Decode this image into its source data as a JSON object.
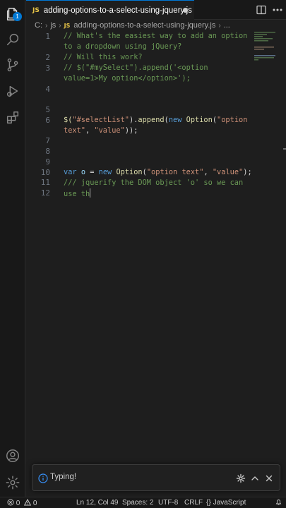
{
  "tab": {
    "icon_text": "JS",
    "title": "adding-options-to-a-select-using-jquery.js"
  },
  "breadcrumb": {
    "drive": "C:",
    "folder": "js",
    "icon_text": "JS",
    "file": "adding-options-to-a-select-using-jquery.js",
    "more": "..."
  },
  "activity": {
    "badge": "1"
  },
  "gutter": {
    "lines": [
      "1",
      "2",
      "3",
      "4",
      "5",
      "6",
      "7",
      "8",
      "9",
      "10",
      "11",
      "12"
    ]
  },
  "code": {
    "l1a": "// What's the easiest way to add an option",
    "l1b": "to a dropdown using jQuery?",
    "l2": "// Will this work?",
    "l3a": "// $(\"#mySelect\").append('<option",
    "l3b": "value=1>My option</option>');",
    "l7_dollar": "$(",
    "l7_sel": "\"#selectList\"",
    "l7_mid": ").",
    "l7_append": "append",
    "l7_paren": "(",
    "l7_new": "new",
    "l7_sp": " ",
    "l7_opt": "Option",
    "l7_p2": "(",
    "l7_s1": "\"option",
    "l7b_s1": "text\"",
    "l7b_comma": ", ",
    "l7b_s2": "\"value\"",
    "l7b_end": "));",
    "l11_var": "var",
    "l11_sp": " ",
    "l11_o": "o",
    "l11_eq": " = ",
    "l11_new": "new",
    "l11_sp2": " ",
    "l11_opt": "Option",
    "l11_p": "(",
    "l11_s1": "\"option text\"",
    "l11_comma": ", ",
    "l11_s2": "\"value\"",
    "l11_end": ");",
    "l12a": "/// jquerify the DOM object 'o' so we can",
    "l12b": "use th"
  },
  "toast": {
    "text": "Typing!"
  },
  "status": {
    "errors": "0",
    "warnings": "0",
    "position": "Ln 12, Col 49",
    "spaces": "Spaces: 2",
    "encoding": "UTF-8",
    "eol": "CRLF",
    "language": "JavaScript"
  },
  "colors": {
    "accent": "#0078d4",
    "editor_bg": "#1e1e1e",
    "comment": "#6a9955",
    "string": "#ce9178",
    "keyword": "#569cd6"
  },
  "icons": [
    "explorer-icon",
    "search-icon",
    "source-control-icon",
    "run-debug-icon",
    "extensions-icon",
    "account-icon",
    "manage-gear-icon"
  ]
}
